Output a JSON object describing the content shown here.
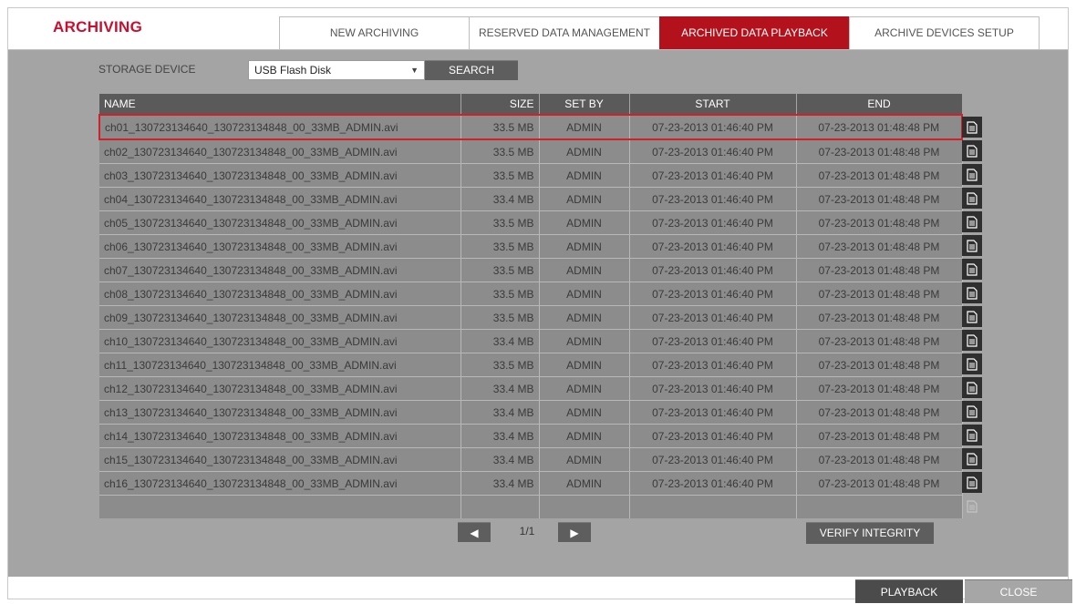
{
  "title": "ARCHIVING",
  "tabs": [
    {
      "label": "NEW ARCHIVING",
      "active": false
    },
    {
      "label": "RESERVED DATA MANAGEMENT",
      "active": false
    },
    {
      "label": "ARCHIVED DATA PLAYBACK",
      "active": true
    },
    {
      "label": "ARCHIVE DEVICES SETUP",
      "active": false
    }
  ],
  "storage": {
    "label": "STORAGE DEVICE",
    "selected": "USB Flash Disk",
    "search_label": "SEARCH"
  },
  "table": {
    "headers": {
      "name": "NAME",
      "size": "SIZE",
      "set_by": "SET BY",
      "start": "START",
      "end": "END"
    },
    "selected_row_index": 0,
    "rows": [
      {
        "name": "ch01_130723134640_130723134848_00_33MB_ADMIN.avi",
        "size": "33.5 MB",
        "set_by": "ADMIN",
        "start": "07-23-2013 01:46:40 PM",
        "end": "07-23-2013 01:48:48 PM"
      },
      {
        "name": "ch02_130723134640_130723134848_00_33MB_ADMIN.avi",
        "size": "33.5 MB",
        "set_by": "ADMIN",
        "start": "07-23-2013 01:46:40 PM",
        "end": "07-23-2013 01:48:48 PM"
      },
      {
        "name": "ch03_130723134640_130723134848_00_33MB_ADMIN.avi",
        "size": "33.5 MB",
        "set_by": "ADMIN",
        "start": "07-23-2013 01:46:40 PM",
        "end": "07-23-2013 01:48:48 PM"
      },
      {
        "name": "ch04_130723134640_130723134848_00_33MB_ADMIN.avi",
        "size": "33.4 MB",
        "set_by": "ADMIN",
        "start": "07-23-2013 01:46:40 PM",
        "end": "07-23-2013 01:48:48 PM"
      },
      {
        "name": "ch05_130723134640_130723134848_00_33MB_ADMIN.avi",
        "size": "33.5 MB",
        "set_by": "ADMIN",
        "start": "07-23-2013 01:46:40 PM",
        "end": "07-23-2013 01:48:48 PM"
      },
      {
        "name": "ch06_130723134640_130723134848_00_33MB_ADMIN.avi",
        "size": "33.5 MB",
        "set_by": "ADMIN",
        "start": "07-23-2013 01:46:40 PM",
        "end": "07-23-2013 01:48:48 PM"
      },
      {
        "name": "ch07_130723134640_130723134848_00_33MB_ADMIN.avi",
        "size": "33.5 MB",
        "set_by": "ADMIN",
        "start": "07-23-2013 01:46:40 PM",
        "end": "07-23-2013 01:48:48 PM"
      },
      {
        "name": "ch08_130723134640_130723134848_00_33MB_ADMIN.avi",
        "size": "33.5 MB",
        "set_by": "ADMIN",
        "start": "07-23-2013 01:46:40 PM",
        "end": "07-23-2013 01:48:48 PM"
      },
      {
        "name": "ch09_130723134640_130723134848_00_33MB_ADMIN.avi",
        "size": "33.5 MB",
        "set_by": "ADMIN",
        "start": "07-23-2013 01:46:40 PM",
        "end": "07-23-2013 01:48:48 PM"
      },
      {
        "name": "ch10_130723134640_130723134848_00_33MB_ADMIN.avi",
        "size": "33.4 MB",
        "set_by": "ADMIN",
        "start": "07-23-2013 01:46:40 PM",
        "end": "07-23-2013 01:48:48 PM"
      },
      {
        "name": "ch11_130723134640_130723134848_00_33MB_ADMIN.avi",
        "size": "33.5 MB",
        "set_by": "ADMIN",
        "start": "07-23-2013 01:46:40 PM",
        "end": "07-23-2013 01:48:48 PM"
      },
      {
        "name": "ch12_130723134640_130723134848_00_33MB_ADMIN.avi",
        "size": "33.4 MB",
        "set_by": "ADMIN",
        "start": "07-23-2013 01:46:40 PM",
        "end": "07-23-2013 01:48:48 PM"
      },
      {
        "name": "ch13_130723134640_130723134848_00_33MB_ADMIN.avi",
        "size": "33.4 MB",
        "set_by": "ADMIN",
        "start": "07-23-2013 01:46:40 PM",
        "end": "07-23-2013 01:48:48 PM"
      },
      {
        "name": "ch14_130723134640_130723134848_00_33MB_ADMIN.avi",
        "size": "33.4 MB",
        "set_by": "ADMIN",
        "start": "07-23-2013 01:46:40 PM",
        "end": "07-23-2013 01:48:48 PM"
      },
      {
        "name": "ch15_130723134640_130723134848_00_33MB_ADMIN.avi",
        "size": "33.4 MB",
        "set_by": "ADMIN",
        "start": "07-23-2013 01:46:40 PM",
        "end": "07-23-2013 01:48:48 PM"
      },
      {
        "name": "ch16_130723134640_130723134848_00_33MB_ADMIN.avi",
        "size": "33.4 MB",
        "set_by": "ADMIN",
        "start": "07-23-2013 01:46:40 PM",
        "end": "07-23-2013 01:48:48 PM"
      }
    ]
  },
  "pager": {
    "text": "1/1"
  },
  "buttons": {
    "verify": "VERIFY INTEGRITY",
    "playback": "PLAYBACK",
    "close": "CLOSE"
  },
  "icons": {
    "row_action": "document-icon",
    "prev": "arrow-left-icon",
    "next": "arrow-right-icon",
    "dropdown": "chevron-down-icon"
  },
  "colors": {
    "accent": "#b3121c",
    "panel": "#a4a4a4",
    "row": "#8c8c8c",
    "header": "#5a5a5a"
  }
}
